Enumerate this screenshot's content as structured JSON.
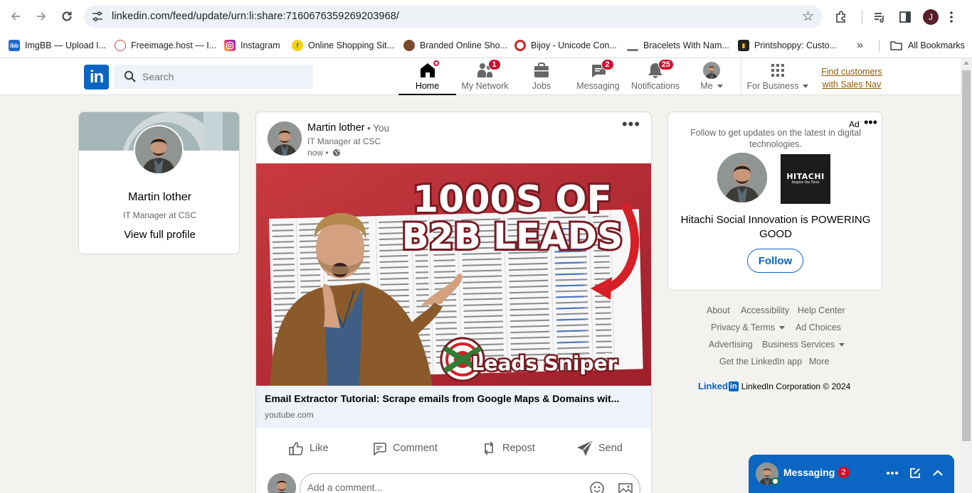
{
  "browser": {
    "url": "linkedin.com/feed/update/urn:li:share:7160676359269203968/",
    "profile_initial": "J",
    "bookmarks": [
      {
        "label": "ImgBB — Upload I...",
        "icon": "imgbb-icon",
        "color": "#1d6ad1"
      },
      {
        "label": "Freeimage.host — I...",
        "icon": "freeimage-icon",
        "color": "#c94a4a"
      },
      {
        "label": "Instagram",
        "icon": "instagram-icon",
        "color": "#d6249f"
      },
      {
        "label": "Online Shopping Sit...",
        "icon": "flipkart-icon",
        "color": "#2874f0"
      },
      {
        "label": "Branded Online Sho...",
        "icon": "shop-icon",
        "color": "#7a4b2a"
      },
      {
        "label": "Bijoy - Unicode Con...",
        "icon": "bijoy-icon",
        "color": "#c62828"
      },
      {
        "label": "Bracelets With Nam...",
        "icon": "bracelet-icon",
        "color": "#777777"
      },
      {
        "label": "Printshoppy: Custo...",
        "icon": "printshoppy-icon",
        "color": "#222222"
      }
    ],
    "all_bookmarks_label": "All Bookmarks"
  },
  "header": {
    "logo_text": "in",
    "search_placeholder": "Search",
    "nav": [
      {
        "label": "Home",
        "badge": ""
      },
      {
        "label": "My Network",
        "badge": "1"
      },
      {
        "label": "Jobs",
        "badge": ""
      },
      {
        "label": "Messaging",
        "badge": "2"
      },
      {
        "label": "Notifications",
        "badge": "25"
      },
      {
        "label": "Me",
        "badge": ""
      },
      {
        "label": "For Business",
        "badge": ""
      }
    ],
    "promo_line1": "Find customers",
    "promo_line2": "with Sales Nav"
  },
  "profile_card": {
    "name": "Martin lother",
    "title": "IT Manager at CSC",
    "link": "View full profile"
  },
  "post": {
    "author": "Martin lother",
    "relation": "• You",
    "subtitle": "IT Manager at CSC",
    "time": "now •",
    "thumbnail": {
      "line1": "1000S OF",
      "line2": "B2B LEADS",
      "brand": "Leads Sniper",
      "tm": "TM"
    },
    "link_title": "Email Extractor Tutorial: Scrape emails from Google Maps & Domains wit...",
    "link_source": "youtube.com",
    "actions": [
      "Like",
      "Comment",
      "Repost",
      "Send"
    ],
    "comment_placeholder": "Add a comment..."
  },
  "ad": {
    "label": "Ad",
    "description": "Follow to get updates on the latest in digital technologies.",
    "logo_brand": "HITACHI",
    "logo_tagline": "Inspire the Next",
    "headline": "Hitachi Social Innovation is POWERING GOOD",
    "follow": "Follow"
  },
  "footer": {
    "links": [
      "About",
      "Accessibility",
      "Help Center",
      "Privacy & Terms",
      "Ad Choices",
      "Advertising",
      "Business Services",
      "Get the LinkedIn app",
      "More"
    ],
    "brand": "Linked",
    "brand_in": "in",
    "copyright": "LinkedIn Corporation © 2024"
  },
  "messaging": {
    "label": "Messaging",
    "badge": "2"
  },
  "colors": {
    "linkedin_blue": "#0a66c2",
    "badge_red": "#cb112d",
    "page_bg": "#f4f2ee",
    "promo_gold": "#915907"
  }
}
